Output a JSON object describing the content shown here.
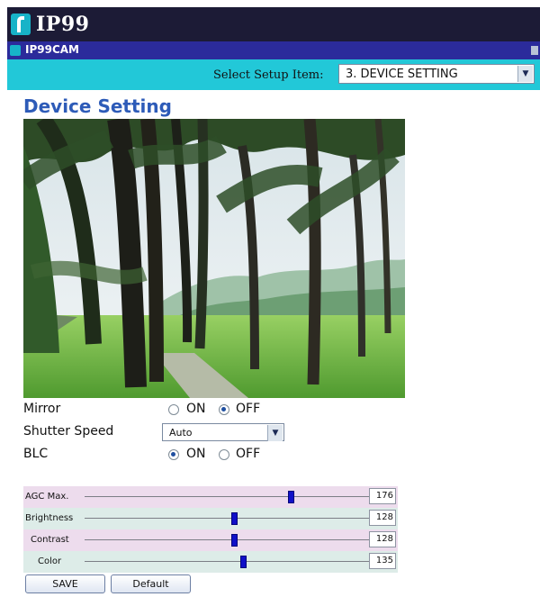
{
  "brand": {
    "logo_text": "IP99"
  },
  "subbar": {
    "title": "IP99CAM"
  },
  "setup": {
    "label": "Select Setup Item:",
    "selected": "3. DEVICE SETTING"
  },
  "page": {
    "title": "Device Setting"
  },
  "controls": {
    "mirror": {
      "label": "Mirror",
      "on": "ON",
      "off": "OFF",
      "selected": "OFF"
    },
    "shutter": {
      "label": "Shutter Speed",
      "value": "Auto"
    },
    "blc": {
      "label": "BLC",
      "on": "ON",
      "off": "OFF",
      "selected": "ON"
    }
  },
  "sliders": [
    {
      "label": "AGC Max.",
      "value": "176",
      "level": 0.69
    },
    {
      "label": "Brightness",
      "value": "128",
      "level": 0.5
    },
    {
      "label": "Contrast",
      "value": "128",
      "level": 0.5
    },
    {
      "label": "Color",
      "value": "135",
      "level": 0.53
    }
  ],
  "buttons": {
    "save": "SAVE",
    "default": "Default"
  },
  "colors": {
    "top_bar": "#1c1b36",
    "sub_bar": "#2b2b9b",
    "cyan_bar": "#22c8d8",
    "title_blue": "#2d5bb8",
    "slider_thumb": "#1010c8"
  },
  "icons": {
    "logo": "ip99-logo-icon",
    "dropdown": "chevron-down-icon",
    "camera": "camera-feed-image"
  }
}
